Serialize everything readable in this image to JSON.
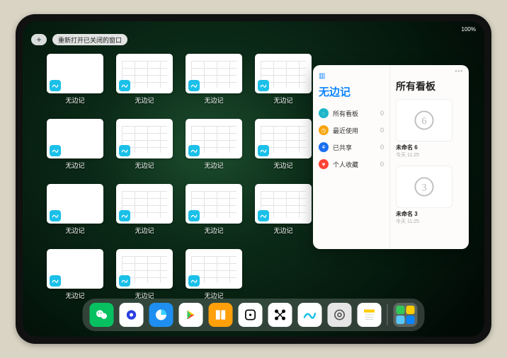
{
  "status": {
    "right": "100%"
  },
  "topbar": {
    "reopen_label": "重新打开已关闭的窗口"
  },
  "windows": {
    "label": "无边记",
    "items": [
      {
        "variant": "blank"
      },
      {
        "variant": "grid"
      },
      {
        "variant": "grid"
      },
      {
        "variant": "grid"
      },
      {
        "variant": "blank"
      },
      {
        "variant": "grid"
      },
      {
        "variant": "grid"
      },
      {
        "variant": "grid"
      },
      {
        "variant": "blank"
      },
      {
        "variant": "grid"
      },
      {
        "variant": "grid"
      },
      {
        "variant": "grid"
      },
      {
        "variant": "blank"
      },
      {
        "variant": "grid"
      },
      {
        "variant": "grid"
      }
    ]
  },
  "panel": {
    "left_title": "无边记",
    "right_title": "所有看板",
    "categories": [
      {
        "icon": "chat",
        "color": "#1db6c9",
        "label": "所有看板",
        "count": "0"
      },
      {
        "icon": "clock",
        "color": "#f7a50b",
        "label": "最近使用",
        "count": "0"
      },
      {
        "icon": "people",
        "color": "#1a6ff0",
        "label": "已共享",
        "count": "0"
      },
      {
        "icon": "heart",
        "color": "#ff4336",
        "label": "个人收藏",
        "count": "0"
      }
    ],
    "boards": [
      {
        "digit": "6",
        "name": "未命名 6",
        "time": "今天 11:25"
      },
      {
        "digit": "3",
        "name": "未命名 3",
        "time": "今天 11:25"
      }
    ]
  },
  "dock": {
    "apps": [
      {
        "name": "wechat",
        "bg": "#07c160"
      },
      {
        "name": "quark",
        "bg": "#fff"
      },
      {
        "name": "qqbrowser",
        "bg": "#1e8ff0"
      },
      {
        "name": "play",
        "bg": "#fff"
      },
      {
        "name": "books",
        "bg": "#ff9f0a"
      },
      {
        "name": "dice",
        "bg": "#fff"
      },
      {
        "name": "nodes",
        "bg": "#fff"
      },
      {
        "name": "freeform",
        "bg": "#fff"
      },
      {
        "name": "settings",
        "bg": "#e5e5e5"
      },
      {
        "name": "notes",
        "bg": "#fff"
      }
    ]
  }
}
